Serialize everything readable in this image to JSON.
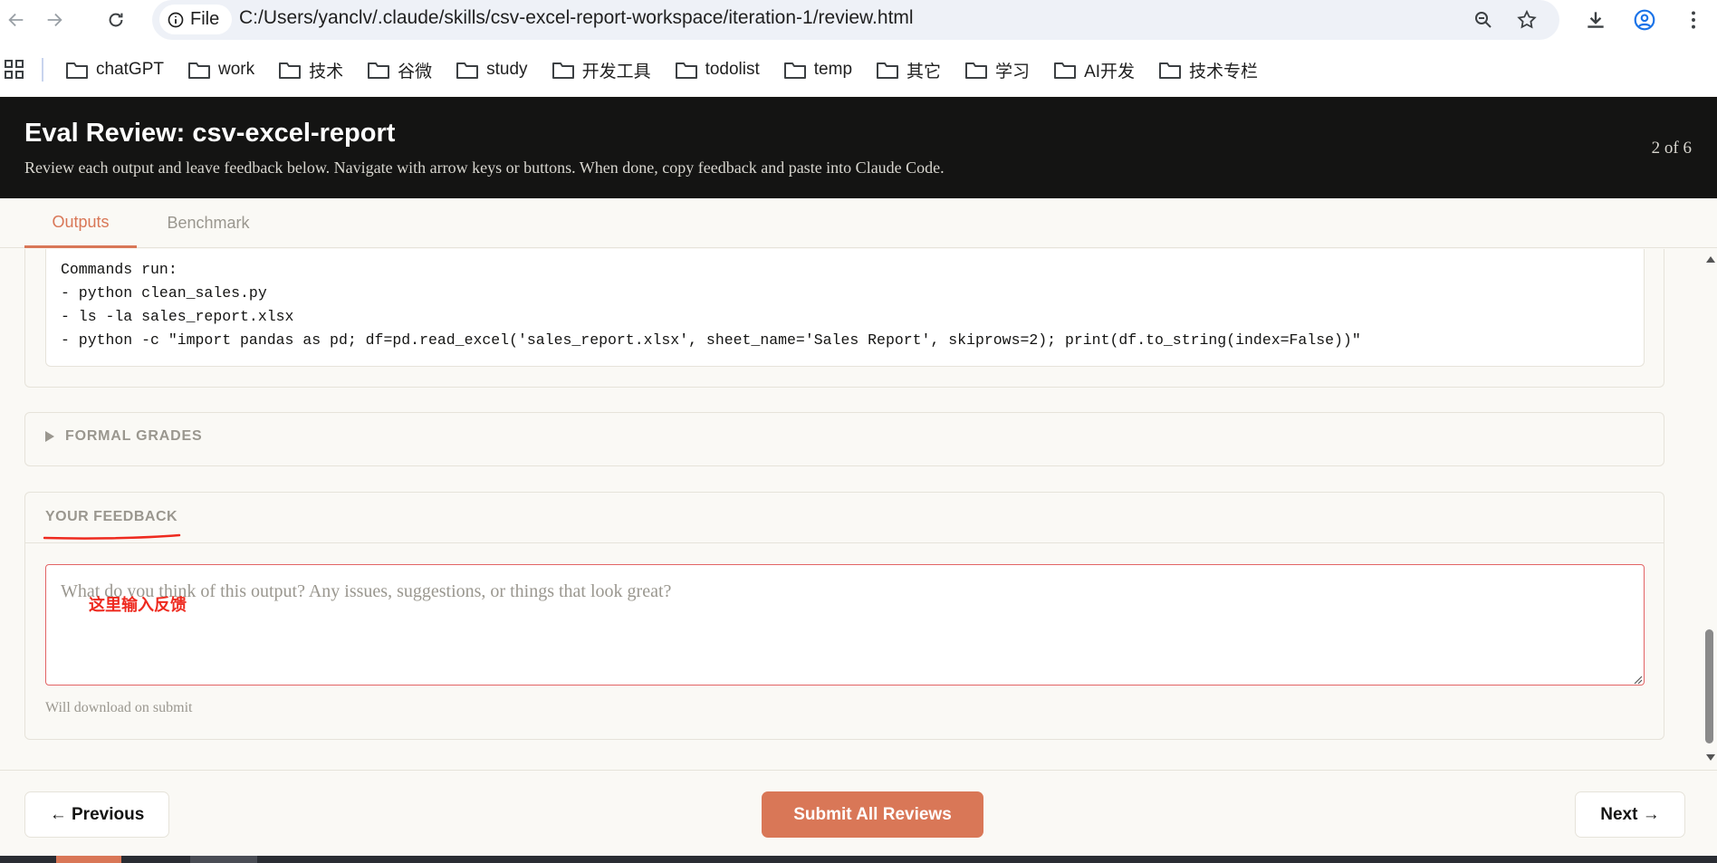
{
  "browser": {
    "file_label": "File",
    "url": "C:/Users/yanclv/.claude/skills/csv-excel-report-workspace/iteration-1/review.html",
    "bookmarks": [
      "chatGPT",
      "work",
      "技术",
      "谷微",
      "study",
      "开发工具",
      "todolist",
      "temp",
      "其它",
      "学习",
      "AI开发",
      "技术专栏"
    ]
  },
  "header": {
    "title": "Eval Review: csv-excel-report",
    "subtitle": "Review each output and leave feedback below. Navigate with arrow keys or buttons. When done, copy feedback and paste into Claude Code.",
    "counter": "2 of 6"
  },
  "tabs": [
    {
      "label": "Outputs",
      "active": true
    },
    {
      "label": "Benchmark",
      "active": false
    }
  ],
  "commands": {
    "lines": [
      "Commands run:",
      "- python clean_sales.py",
      "- ls -la sales_report.xlsx",
      "- python -c \"import pandas as pd; df=pd.read_excel('sales_report.xlsx', sheet_name='Sales Report', skiprows=2); print(df.to_string(index=False))\""
    ]
  },
  "grades": {
    "label": "FORMAL GRADES"
  },
  "feedback": {
    "label": "YOUR FEEDBACK",
    "placeholder": "What do you think of this output? Any issues, suggestions, or things that look great?",
    "annotation": "这里输入反馈",
    "hint": "Will download on submit"
  },
  "footer": {
    "prev_label": "← Previous",
    "submit_label": "Submit All Reviews",
    "next_label": "Next →"
  },
  "colors": {
    "accent": "#d97757",
    "header_bg": "#141413",
    "annotation_red": "#ee2a1f"
  }
}
